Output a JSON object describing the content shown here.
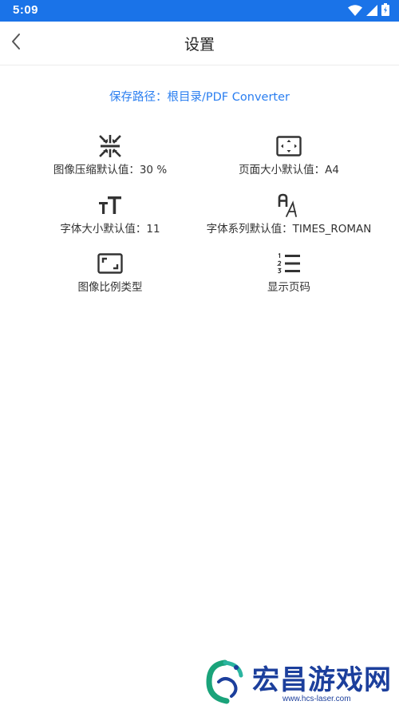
{
  "status_bar": {
    "time": "5:09",
    "icons": [
      "wifi-icon",
      "signal-icon",
      "battery-icon"
    ],
    "color": "#1a73e8"
  },
  "header": {
    "title": "设置",
    "back_icon": "chevron-left-icon"
  },
  "save_path": {
    "text": "保存路径：根目录/PDF Converter",
    "color": "#2a7ef0"
  },
  "settings": [
    {
      "icon": "compress-icon",
      "label": "图像压缩默认值：30 %"
    },
    {
      "icon": "page-size-icon",
      "label": "页面大小默认值：A4"
    },
    {
      "icon": "font-size-icon",
      "label": "字体大小默认值：11"
    },
    {
      "icon": "font-family-icon",
      "label": "字体系列默认值：TIMES_ROMAN"
    },
    {
      "icon": "aspect-ratio-icon",
      "label": "图像比例类型"
    },
    {
      "icon": "numbered-list-icon",
      "label": "显示页码"
    }
  ],
  "watermark": {
    "brand": "宏昌游戏网",
    "domain": "www.hcs-laser.com",
    "color": "#1c3f9c"
  }
}
